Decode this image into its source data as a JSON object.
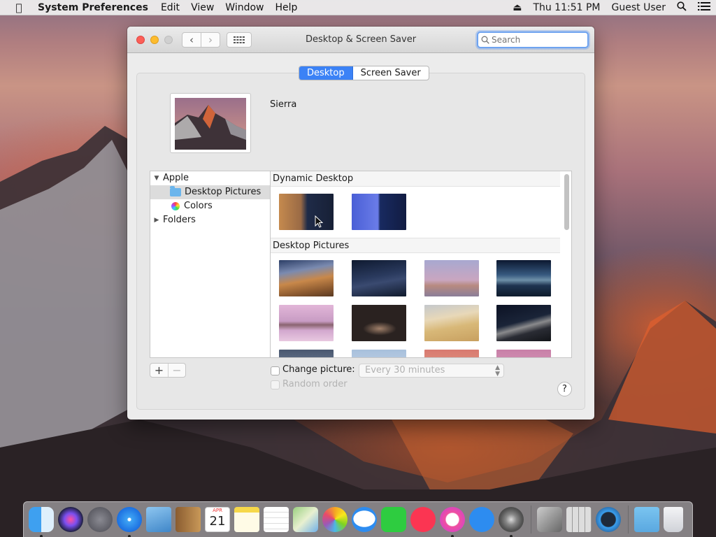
{
  "menubar": {
    "app_name": "System Preferences",
    "items": [
      "Edit",
      "View",
      "Window",
      "Help"
    ],
    "clock": "Thu 11:51 PM",
    "user": "Guest User"
  },
  "window": {
    "title": "Desktop & Screen Saver",
    "search_placeholder": "Search",
    "tabs": [
      "Desktop",
      "Screen Saver"
    ],
    "current_wallpaper": "Sierra",
    "sidebar": {
      "groups": [
        {
          "label": "Apple",
          "expanded": true,
          "items": [
            {
              "label": "Desktop Pictures",
              "selected": true
            },
            {
              "label": "Colors",
              "selected": false
            }
          ]
        },
        {
          "label": "Folders",
          "expanded": false,
          "items": []
        }
      ]
    },
    "sections": [
      "Dynamic Desktop",
      "Desktop Pictures"
    ],
    "change_picture_label": "Change picture:",
    "interval": "Every 30 minutes",
    "random_label": "Random order",
    "add_label": "+",
    "remove_label": "−",
    "help_label": "?"
  },
  "dock": [
    "finder",
    "siri",
    "launchpad",
    "safari",
    "preview",
    "contacts",
    "calendar",
    "notes",
    "reminders",
    "maps",
    "photos",
    "messages",
    "facetime",
    "news",
    "itunes",
    "app-store",
    "system-preferences",
    "script-editor",
    "calculator",
    "quicktime",
    "downloads",
    "trash"
  ],
  "calendar_month": "APR",
  "calendar_day": "21"
}
